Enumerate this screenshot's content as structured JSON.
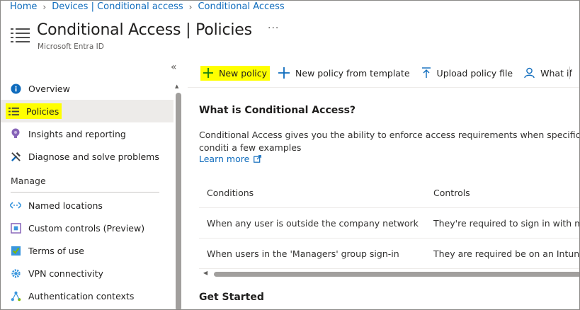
{
  "breadcrumb": {
    "items": [
      "Home",
      "Devices | Conditional access",
      "Conditional Access"
    ]
  },
  "header": {
    "title": "Conditional Access | Policies",
    "subtitle": "Microsoft Entra ID",
    "more": "···"
  },
  "sidebar": {
    "collapse": "«",
    "items": [
      {
        "label": "Overview",
        "icon": "info-icon"
      },
      {
        "label": "Policies",
        "icon": "list-icon"
      },
      {
        "label": "Insights and reporting",
        "icon": "lightbulb-icon"
      },
      {
        "label": "Diagnose and solve problems",
        "icon": "wrench-icon"
      }
    ],
    "manage_header": "Manage",
    "manage_items": [
      {
        "label": "Named locations",
        "icon": "named-locations-icon"
      },
      {
        "label": "Custom controls (Preview)",
        "icon": "custom-controls-icon"
      },
      {
        "label": "Terms of use",
        "icon": "terms-of-use-icon"
      },
      {
        "label": "VPN connectivity",
        "icon": "vpn-gear-icon"
      },
      {
        "label": "Authentication contexts",
        "icon": "auth-context-icon"
      }
    ]
  },
  "toolbar": {
    "new_policy": "New policy",
    "new_from_template": "New policy from template",
    "upload": "Upload policy file",
    "what_if": "What if"
  },
  "content": {
    "title": "What is Conditional Access?",
    "description": "Conditional Access gives you the ability to enforce access requirements when specific conditi a few examples",
    "learn_more": "Learn more",
    "table": {
      "headers": [
        "Conditions",
        "Controls"
      ],
      "rows": [
        [
          "When any user is outside the company network",
          "They're required to sign in with mul"
        ],
        [
          "When users in the 'Managers' group sign-in",
          "They are required be on an Intune c"
        ]
      ]
    },
    "get_started": "Get Started"
  },
  "colors": {
    "link": "#0f6cbd",
    "highlight": "#ffff00",
    "selected_bg": "#edebe9"
  }
}
